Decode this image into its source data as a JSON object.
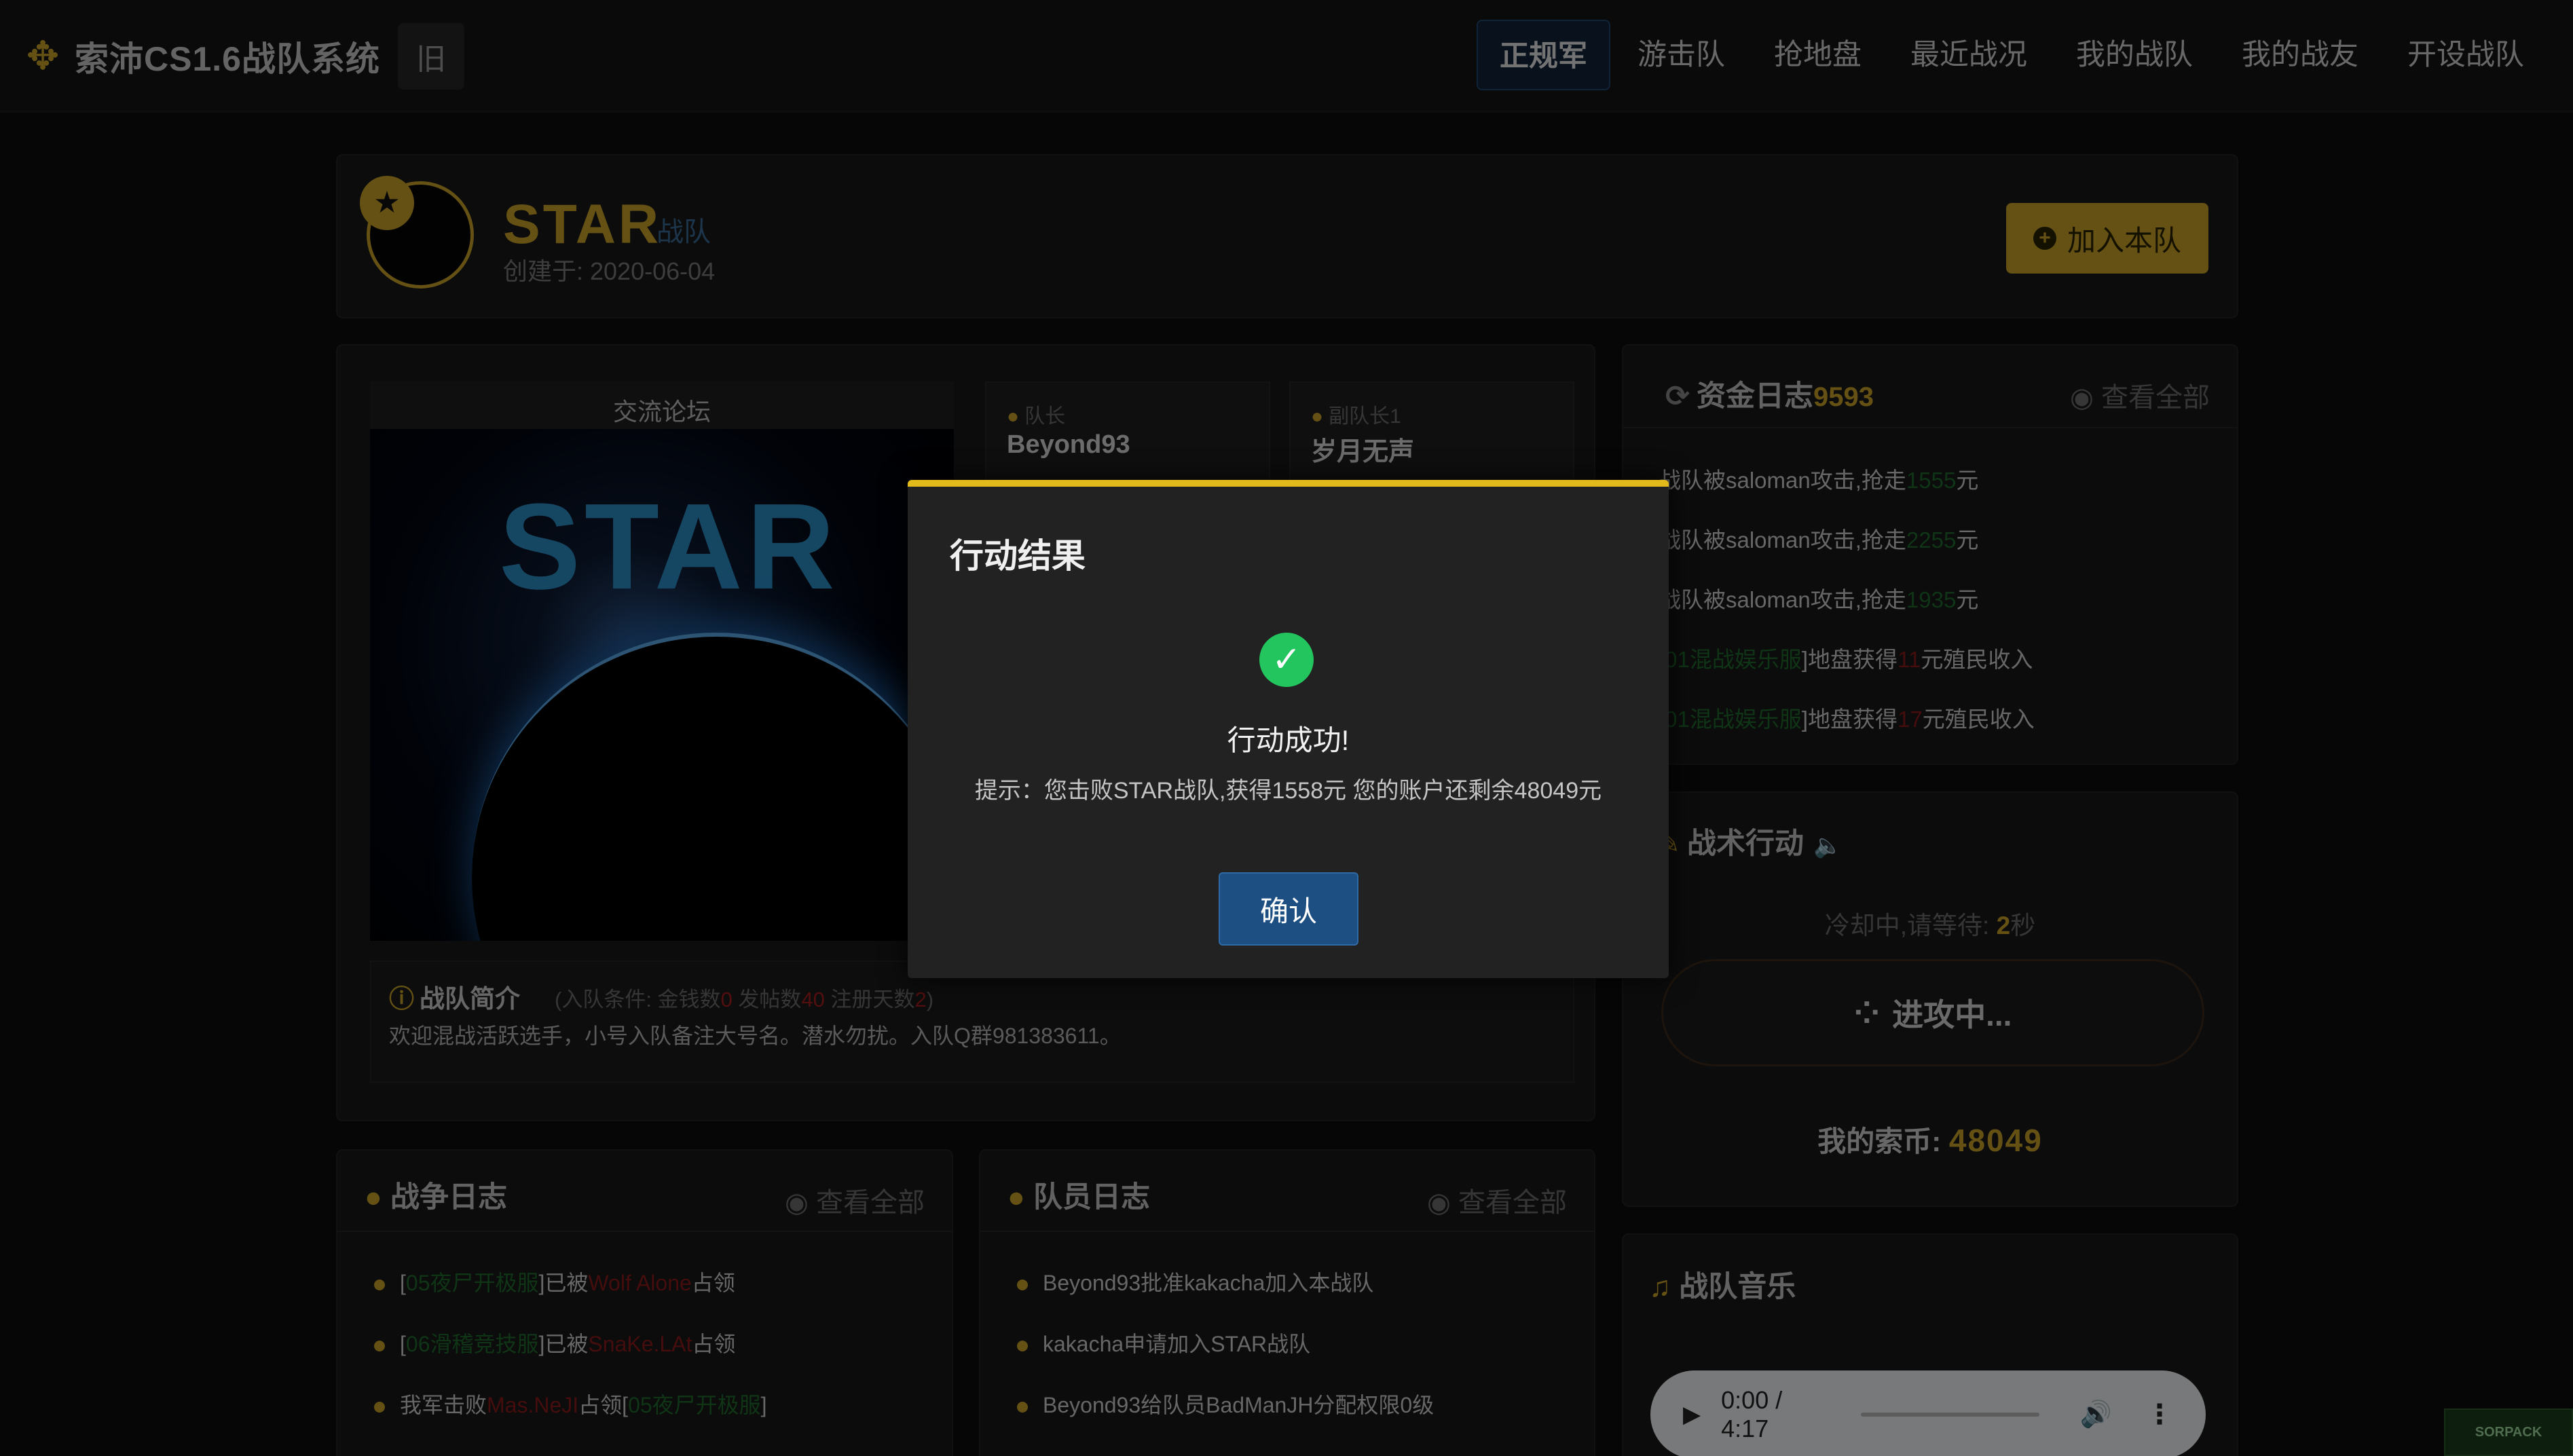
{
  "nav": {
    "brand": "索沛CS1.6战队系统",
    "old_label": "旧",
    "items": [
      "正规军",
      "游击队",
      "抢地盘",
      "最近战况",
      "我的战队",
      "我的战友",
      "开设战队"
    ],
    "active_index": 0
  },
  "team": {
    "name": "STAR",
    "suffix": "战队",
    "created": "创建于: 2020-06-04",
    "join_label": "加入本队"
  },
  "forum": {
    "title": "交流论坛",
    "image_text": "STAR"
  },
  "leaders": {
    "captain_label": "队长",
    "captain_name": "Beyond93",
    "vice_label": "副队长1",
    "vice_name": "岁月无声"
  },
  "intro": {
    "title": "战队简介",
    "cond_prefix": "(入队条件: 金钱数",
    "cond_money": "0",
    "cond_posts_label": " 发帖数",
    "cond_posts": "40",
    "cond_days_label": " 注册天数",
    "cond_days": "2",
    "cond_suffix": ")",
    "text": "欢迎混战活跃选手，小号入队备注大号名。潜水勿扰。入队Q群981383611。"
  },
  "fund_log": {
    "title": "资金日志",
    "count": "9593",
    "view_all": "查看全部",
    "rows": [
      {
        "pre": "战队被saloman攻击,抢走",
        "amt": "1555",
        "post": "元",
        "type": "g"
      },
      {
        "pre": "战队被saloman攻击,抢走",
        "amt": "2255",
        "post": "元",
        "type": "g"
      },
      {
        "pre": "战队被saloman攻击,抢走",
        "amt": "1935",
        "post": "元",
        "type": "g"
      },
      {
        "pre": "[",
        "tag": "01混战娱乐服",
        "mid": "]地盘获得",
        "amt": "11",
        "post": "元殖民收入",
        "type": "r"
      },
      {
        "pre": "[",
        "tag": "01混战娱乐服",
        "mid": "]地盘获得",
        "amt": "17",
        "post": "元殖民收入",
        "type": "r"
      }
    ]
  },
  "tactic": {
    "title": "战术行动",
    "cooldown_prefix": "冷却中,请等待: ",
    "cooldown_sec": "2",
    "cooldown_suffix": "秒",
    "attack_label": "进攻中...",
    "coins_label": "我的索币: ",
    "coins_value": "48049"
  },
  "music": {
    "title": "战队音乐",
    "time": "0:00 / 4:17"
  },
  "war_log": {
    "title": "战争日志",
    "view_all": "查看全部",
    "rows": [
      {
        "a": "[",
        "b": "05夜尸开极服",
        "c": "]已被",
        "d": "Wolf Alone",
        "e": "占领"
      },
      {
        "a": "[",
        "b": "06滑稽竞技服",
        "c": "]已被",
        "d": "SnaKe.LAt",
        "e": "占领"
      },
      {
        "a": "我军击败",
        "b": "Mas.NeJI",
        "c": "占领[",
        "d": "05夜尸开极服",
        "e": "]"
      }
    ]
  },
  "member_log": {
    "title": "队员日志",
    "view_all": "查看全部",
    "rows": [
      "Beyond93批准kakacha加入本战队",
      "kakacha申请加入STAR战队",
      "Beyond93给队员BadManJH分配权限0级"
    ]
  },
  "modal": {
    "title": "行动结果",
    "success": "行动成功!",
    "message": "提示：您击败STAR战队,获得1558元 您的账户还剩余48049元",
    "confirm": "确认"
  },
  "colors": {
    "accent_gold": "#c9a227",
    "modal_border": "#e2ba1a",
    "success_green": "#22c55e",
    "confirm_blue": "#1d4f82"
  }
}
